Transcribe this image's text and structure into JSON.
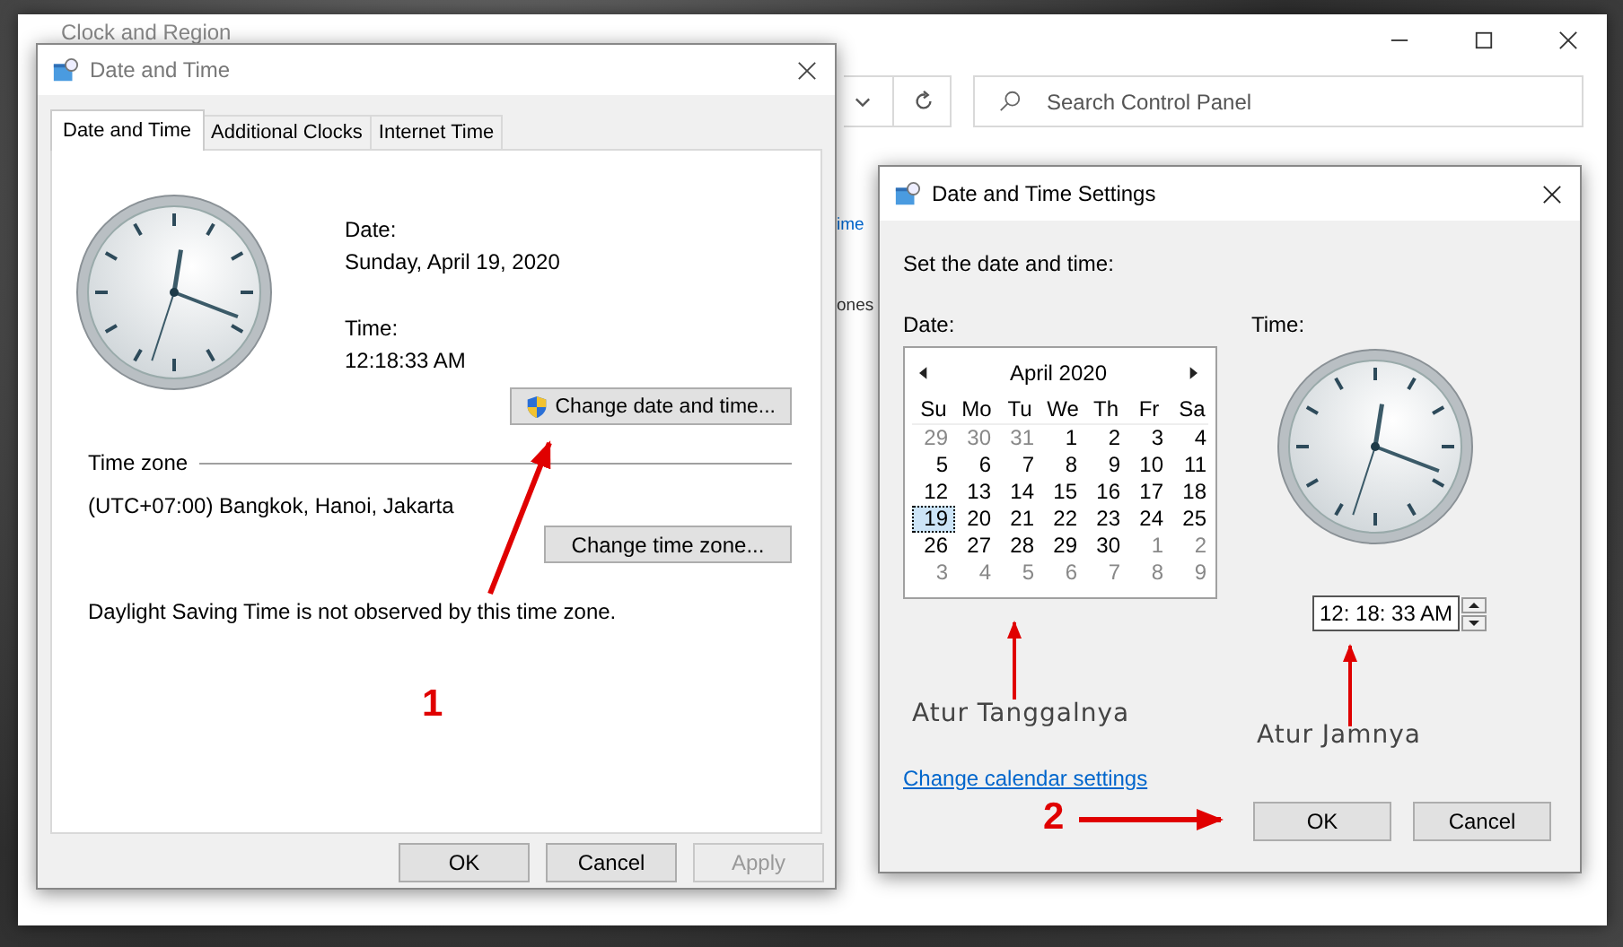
{
  "background_window": {
    "title": "Clock and Region",
    "search": {
      "placeholder": "Search Control Panel"
    },
    "fragments": [
      {
        "text": "ime",
        "kind": "link"
      },
      {
        "text": "ones",
        "kind": "text"
      }
    ]
  },
  "dialog": {
    "title": "Date and Time",
    "tabs": [
      {
        "label": "Date and Time",
        "selected": true
      },
      {
        "label": "Additional Clocks",
        "selected": false
      },
      {
        "label": "Internet Time",
        "selected": false
      }
    ],
    "date_label": "Date:",
    "date_value": "Sunday, April 19, 2020",
    "time_label": "Time:",
    "time_value": "12:18:33 AM",
    "change_datetime_button": "Change date and time...",
    "timezone_heading": "Time zone",
    "timezone_value": "(UTC+07:00) Bangkok, Hanoi, Jakarta",
    "change_timezone_button": "Change time zone...",
    "dst_note": "Daylight Saving Time is not observed by this time zone.",
    "buttons": [
      {
        "label": "OK",
        "disabled": false
      },
      {
        "label": "Cancel",
        "disabled": false
      },
      {
        "label": "Apply",
        "disabled": true
      }
    ]
  },
  "settings_dialog": {
    "title": "Date and Time Settings",
    "instruction": "Set the date and time:",
    "date_label": "Date:",
    "calendar": {
      "month": "April 2020",
      "weekdays": [
        "Su",
        "Mo",
        "Tu",
        "We",
        "Th",
        "Fr",
        "Sa"
      ],
      "weeks": [
        [
          {
            "day": "29",
            "other_month": true,
            "selected": false
          },
          {
            "day": "30",
            "other_month": true,
            "selected": false
          },
          {
            "day": "31",
            "other_month": true,
            "selected": false
          },
          {
            "day": "1",
            "other_month": false,
            "selected": false
          },
          {
            "day": "2",
            "other_month": false,
            "selected": false
          },
          {
            "day": "3",
            "other_month": false,
            "selected": false
          },
          {
            "day": "4",
            "other_month": false,
            "selected": false
          }
        ],
        [
          {
            "day": "5",
            "other_month": false,
            "selected": false
          },
          {
            "day": "6",
            "other_month": false,
            "selected": false
          },
          {
            "day": "7",
            "other_month": false,
            "selected": false
          },
          {
            "day": "8",
            "other_month": false,
            "selected": false
          },
          {
            "day": "9",
            "other_month": false,
            "selected": false
          },
          {
            "day": "10",
            "other_month": false,
            "selected": false
          },
          {
            "day": "11",
            "other_month": false,
            "selected": false
          }
        ],
        [
          {
            "day": "12",
            "other_month": false,
            "selected": false
          },
          {
            "day": "13",
            "other_month": false,
            "selected": false
          },
          {
            "day": "14",
            "other_month": false,
            "selected": false
          },
          {
            "day": "15",
            "other_month": false,
            "selected": false
          },
          {
            "day": "16",
            "other_month": false,
            "selected": false
          },
          {
            "day": "17",
            "other_month": false,
            "selected": false
          },
          {
            "day": "18",
            "other_month": false,
            "selected": false
          }
        ],
        [
          {
            "day": "19",
            "other_month": false,
            "selected": true
          },
          {
            "day": "20",
            "other_month": false,
            "selected": false
          },
          {
            "day": "21",
            "other_month": false,
            "selected": false
          },
          {
            "day": "22",
            "other_month": false,
            "selected": false
          },
          {
            "day": "23",
            "other_month": false,
            "selected": false
          },
          {
            "day": "24",
            "other_month": false,
            "selected": false
          },
          {
            "day": "25",
            "other_month": false,
            "selected": false
          }
        ],
        [
          {
            "day": "26",
            "other_month": false,
            "selected": false
          },
          {
            "day": "27",
            "other_month": false,
            "selected": false
          },
          {
            "day": "28",
            "other_month": false,
            "selected": false
          },
          {
            "day": "29",
            "other_month": false,
            "selected": false
          },
          {
            "day": "30",
            "other_month": false,
            "selected": false
          },
          {
            "day": "1",
            "other_month": true,
            "selected": false
          },
          {
            "day": "2",
            "other_month": true,
            "selected": false
          }
        ],
        [
          {
            "day": "3",
            "other_month": true,
            "selected": false
          },
          {
            "day": "4",
            "other_month": true,
            "selected": false
          },
          {
            "day": "5",
            "other_month": true,
            "selected": false
          },
          {
            "day": "6",
            "other_month": true,
            "selected": false
          },
          {
            "day": "7",
            "other_month": true,
            "selected": false
          },
          {
            "day": "8",
            "other_month": true,
            "selected": false
          },
          {
            "day": "9",
            "other_month": true,
            "selected": false
          }
        ]
      ]
    },
    "time_label": "Time:",
    "time_value": "12: 18: 33 AM",
    "calendar_link": "Change calendar settings",
    "buttons": [
      {
        "label": "OK",
        "disabled": false
      },
      {
        "label": "Cancel",
        "disabled": false
      }
    ]
  },
  "annotations": [
    {
      "label": "1"
    },
    {
      "label": "Atur Tanggalnya"
    },
    {
      "label": "Atur Jamnya"
    },
    {
      "label": "2"
    }
  ]
}
